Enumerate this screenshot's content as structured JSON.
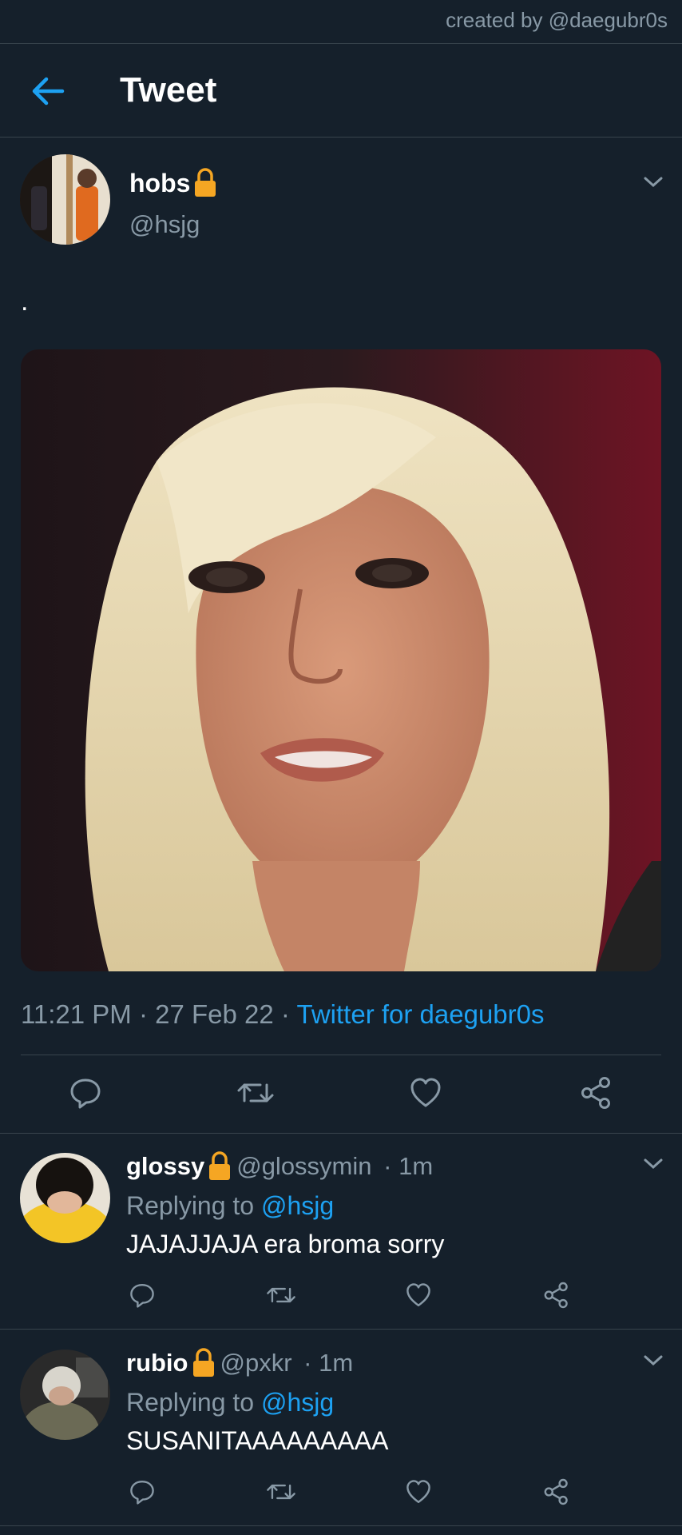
{
  "watermark": "created by @daegubr0s",
  "header": {
    "title": "Tweet",
    "back_icon": "arrow-left-icon"
  },
  "tweet": {
    "name": "hobs",
    "handle": "@hsjg",
    "text": ".",
    "time": "11:21 PM",
    "date": "27 Feb 22",
    "source": "Twitter for daegubr0s",
    "meta_sep": " · "
  },
  "replies": [
    {
      "name": "glossy",
      "handle": "@glossymin",
      "time": "1m",
      "replying_label": "Replying to",
      "replying_to": "@hsjg",
      "text": "JAJAJJAJA era broma sorry"
    },
    {
      "name": "rubio",
      "handle": "@pxkr",
      "time": "1m",
      "replying_label": "Replying to",
      "replying_to": "@hsjg",
      "text": "SUSANITAAAAAAAAA"
    }
  ],
  "colors": {
    "background": "#15202b",
    "accent": "#1da1f2",
    "muted": "#8899a6",
    "divider": "#38444d",
    "lock": "#f5a623"
  }
}
